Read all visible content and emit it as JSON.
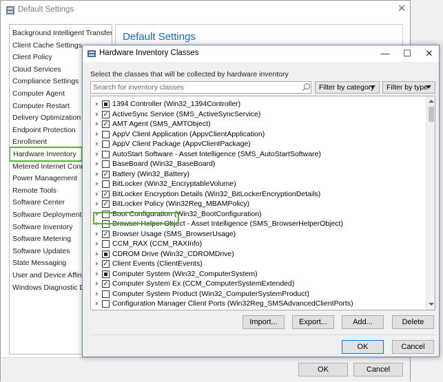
{
  "colors": {
    "accent_highlight": "#58b233",
    "heading_blue": "#1565c0",
    "primary_border": "#0078d7"
  },
  "background_window": {
    "title": "Default Settings",
    "heading": "Default Settings",
    "nav_items": [
      "Background Intelligent Transfer",
      "Client Cache Settings",
      "Client Policy",
      "Cloud Services",
      "Compliance Settings",
      "Computer Agent",
      "Computer Restart",
      "Delivery Optimization",
      "Endpoint Protection",
      "Enrollment",
      "Hardware Inventory",
      "Metered Internet Connections",
      "Power Management",
      "Remote Tools",
      "Software Center",
      "Software Deployment",
      "Software Inventory",
      "Software Metering",
      "Software Updates",
      "State Messaging",
      "User and Device Affinity",
      "Windows Diagnostic Data"
    ],
    "selected_nav_item": "Hardware Inventory",
    "ok_label": "OK",
    "cancel_label": "Cancel"
  },
  "dialog": {
    "title": "Hardware Inventory Classes",
    "description": "Select the classes that will be collected by hardware inventory",
    "search_placeholder": "Search for inventory classes",
    "filter_category_label": "Filter by category",
    "filter_type_label": "Filter by type",
    "classes": [
      {
        "label": "1394 Controller (Win32_1394Controller)",
        "state": "partial"
      },
      {
        "label": "ActiveSync Service (SMS_ActiveSyncService)",
        "state": "checked"
      },
      {
        "label": "AMT Agent (SMS_AMTObject)",
        "state": "checked"
      },
      {
        "label": "AppV Client Application (AppvClientApplication)",
        "state": "unchecked"
      },
      {
        "label": "AppV Client Package (AppvClientPackage)",
        "state": "unchecked"
      },
      {
        "label": "AutoStart Software - Asset Intelligence (SMS_AutoStartSoftware)",
        "state": "unchecked"
      },
      {
        "label": "BaseBoard (Win32_BaseBoard)",
        "state": "unchecked"
      },
      {
        "label": "Battery (Win32_Battery)",
        "state": "checked"
      },
      {
        "label": "BitLocker (Win32_EncryptableVolume)",
        "state": "unchecked"
      },
      {
        "label": "BitLocker Encryption Details (Win32_BitLockerEncryptionDetails)",
        "state": "checked"
      },
      {
        "label": "BitLocker Policy (Win32Reg_MBAMPolicy)",
        "state": "checked"
      },
      {
        "label": "Boot Configuration (Win32_BootConfiguration)",
        "state": "unchecked"
      },
      {
        "label": "Browser Helper Object - Asset Intelligence (SMS_BrowserHelperObject)",
        "state": "unchecked"
      },
      {
        "label": "Browser Usage (SMS_BrowserUsage)",
        "state": "checked"
      },
      {
        "label": "CCM_RAX (CCM_RAXInfo)",
        "state": "unchecked"
      },
      {
        "label": "CDROM Drive (Win32_CDROMDrive)",
        "state": "partial"
      },
      {
        "label": "Client Events (ClientEvents)",
        "state": "checked"
      },
      {
        "label": "Computer System (Win32_ComputerSystem)",
        "state": "partial"
      },
      {
        "label": "Computer System Ex (CCM_ComputerSystemExtended)",
        "state": "checked"
      },
      {
        "label": "Computer System Product (Win32_ComputerSystemProduct)",
        "state": "unchecked"
      },
      {
        "label": "Configuration Manager Client Ports (Win32Reg_SMSAdvancedClientPorts)",
        "state": "unchecked"
      }
    ],
    "highlighted_class": "Battery (Win32_Battery)",
    "import_label": "Import...",
    "export_label": "Export...",
    "add_label": "Add...",
    "delete_label": "Delete",
    "ok_label": "OK",
    "cancel_label": "Cancel"
  }
}
